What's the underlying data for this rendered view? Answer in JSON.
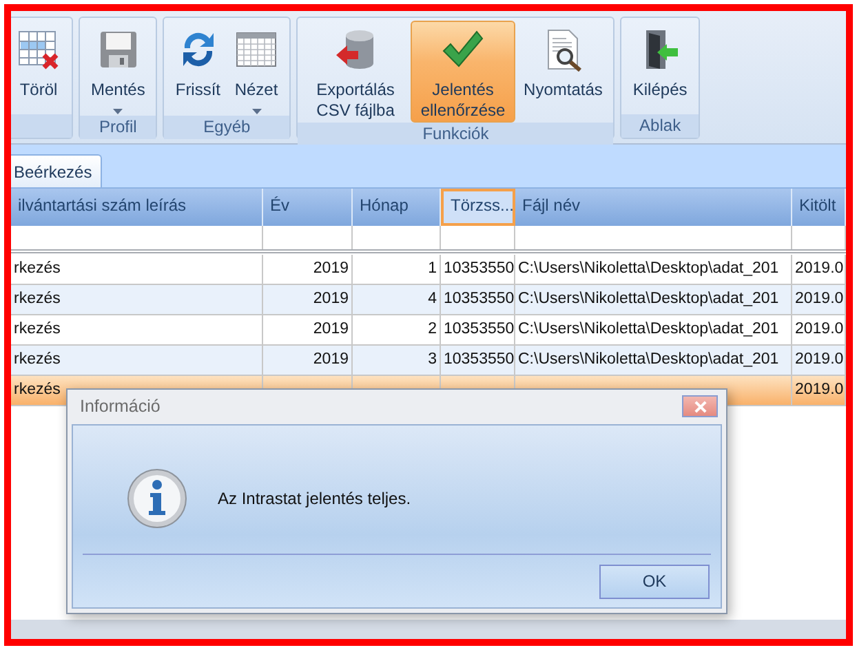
{
  "ribbon": {
    "groups": [
      {
        "buttons": [
          {
            "label": "Töröl",
            "dropdown": false,
            "selected": false
          }
        ]
      },
      {
        "label": "Profil",
        "buttons": [
          {
            "label": "Mentés",
            "dropdown": true,
            "selected": false
          }
        ]
      },
      {
        "label": "Egyéb",
        "buttons": [
          {
            "label": "Frissít",
            "dropdown": false,
            "selected": false
          },
          {
            "label": "Nézet",
            "dropdown": true,
            "selected": false
          }
        ]
      },
      {
        "label": "Funkciók",
        "buttons": [
          {
            "label": "Exportálás CSV fájlba",
            "dropdown": false,
            "selected": false
          },
          {
            "label": "Jelentés ellenőrzése",
            "dropdown": false,
            "selected": true
          },
          {
            "label": "Nyomtatás",
            "dropdown": false,
            "selected": false
          }
        ]
      },
      {
        "label": "Ablak",
        "buttons": [
          {
            "label": "Kilépés",
            "dropdown": false,
            "selected": false
          }
        ]
      }
    ]
  },
  "tabs": [
    {
      "label": "Beérkezés",
      "selected": true
    }
  ],
  "table": {
    "columns": [
      {
        "label": "ilvántartási szám leírás",
        "focused": false
      },
      {
        "label": "Év",
        "focused": false
      },
      {
        "label": "Hónap",
        "focused": false
      },
      {
        "label": "Törzss...",
        "focused": true
      },
      {
        "label": "Fájl név",
        "focused": false
      },
      {
        "label": "Kitölt",
        "focused": false
      }
    ],
    "rows": [
      {
        "selected": false,
        "cells": [
          "rkezés",
          "2019",
          "1",
          "10353550",
          "C:\\Users\\Nikoletta\\Desktop\\adat_201",
          "2019.0"
        ]
      },
      {
        "selected": false,
        "cells": [
          "rkezés",
          "2019",
          "4",
          "10353550",
          "C:\\Users\\Nikoletta\\Desktop\\adat_201",
          "2019.0"
        ]
      },
      {
        "selected": false,
        "cells": [
          "rkezés",
          "2019",
          "2",
          "10353550",
          "C:\\Users\\Nikoletta\\Desktop\\adat_201",
          "2019.0"
        ]
      },
      {
        "selected": false,
        "cells": [
          "rkezés",
          "2019",
          "3",
          "10353550",
          "C:\\Users\\Nikoletta\\Desktop\\adat_201",
          "2019.0"
        ]
      },
      {
        "selected": true,
        "cells": [
          "rkezés",
          null,
          null,
          null,
          null,
          "2019.0"
        ]
      }
    ]
  },
  "dialog": {
    "title": "Információ",
    "message": "Az Intrastat jelentés teljes.",
    "button": "OK"
  }
}
